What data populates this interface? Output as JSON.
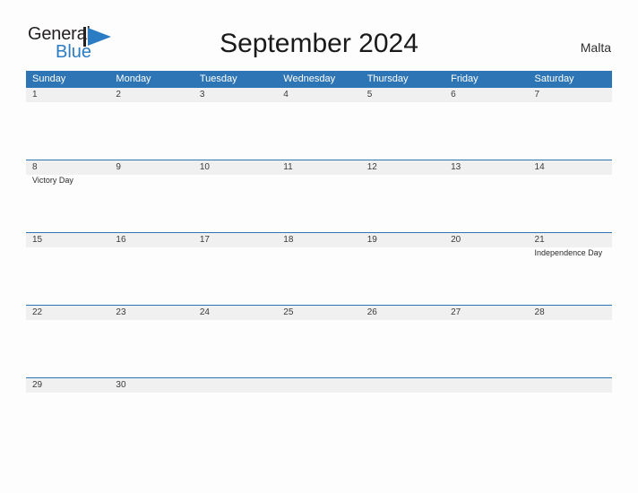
{
  "brand": {
    "name_part1": "General",
    "name_part2": "Blue",
    "flag_icon": "flag-icon",
    "accent_color": "#2b7cc3"
  },
  "header": {
    "title": "September 2024",
    "country": "Malta"
  },
  "theme": {
    "header_blue": "#2e75b6",
    "band_gray": "#f0f0f0",
    "page_background": "#fdfdfd",
    "text_color": "#3a3a3a"
  },
  "calendar": {
    "month": "September",
    "year": "2024",
    "weekday_headers": [
      "Sunday",
      "Monday",
      "Tuesday",
      "Wednesday",
      "Thursday",
      "Friday",
      "Saturday"
    ],
    "weeks": [
      {
        "days": [
          {
            "number": "1",
            "events": []
          },
          {
            "number": "2",
            "events": []
          },
          {
            "number": "3",
            "events": []
          },
          {
            "number": "4",
            "events": []
          },
          {
            "number": "5",
            "events": []
          },
          {
            "number": "6",
            "events": []
          },
          {
            "number": "7",
            "events": []
          }
        ]
      },
      {
        "days": [
          {
            "number": "8",
            "events": [
              "Victory Day"
            ]
          },
          {
            "number": "9",
            "events": []
          },
          {
            "number": "10",
            "events": []
          },
          {
            "number": "11",
            "events": []
          },
          {
            "number": "12",
            "events": []
          },
          {
            "number": "13",
            "events": []
          },
          {
            "number": "14",
            "events": []
          }
        ]
      },
      {
        "days": [
          {
            "number": "15",
            "events": []
          },
          {
            "number": "16",
            "events": []
          },
          {
            "number": "17",
            "events": []
          },
          {
            "number": "18",
            "events": []
          },
          {
            "number": "19",
            "events": []
          },
          {
            "number": "20",
            "events": []
          },
          {
            "number": "21",
            "events": [
              "Independence Day"
            ]
          }
        ]
      },
      {
        "days": [
          {
            "number": "22",
            "events": []
          },
          {
            "number": "23",
            "events": []
          },
          {
            "number": "24",
            "events": []
          },
          {
            "number": "25",
            "events": []
          },
          {
            "number": "26",
            "events": []
          },
          {
            "number": "27",
            "events": []
          },
          {
            "number": "28",
            "events": []
          }
        ]
      },
      {
        "days": [
          {
            "number": "29",
            "events": []
          },
          {
            "number": "30",
            "events": []
          },
          {
            "number": "",
            "events": []
          },
          {
            "number": "",
            "events": []
          },
          {
            "number": "",
            "events": []
          },
          {
            "number": "",
            "events": []
          },
          {
            "number": "",
            "events": []
          }
        ]
      }
    ]
  }
}
